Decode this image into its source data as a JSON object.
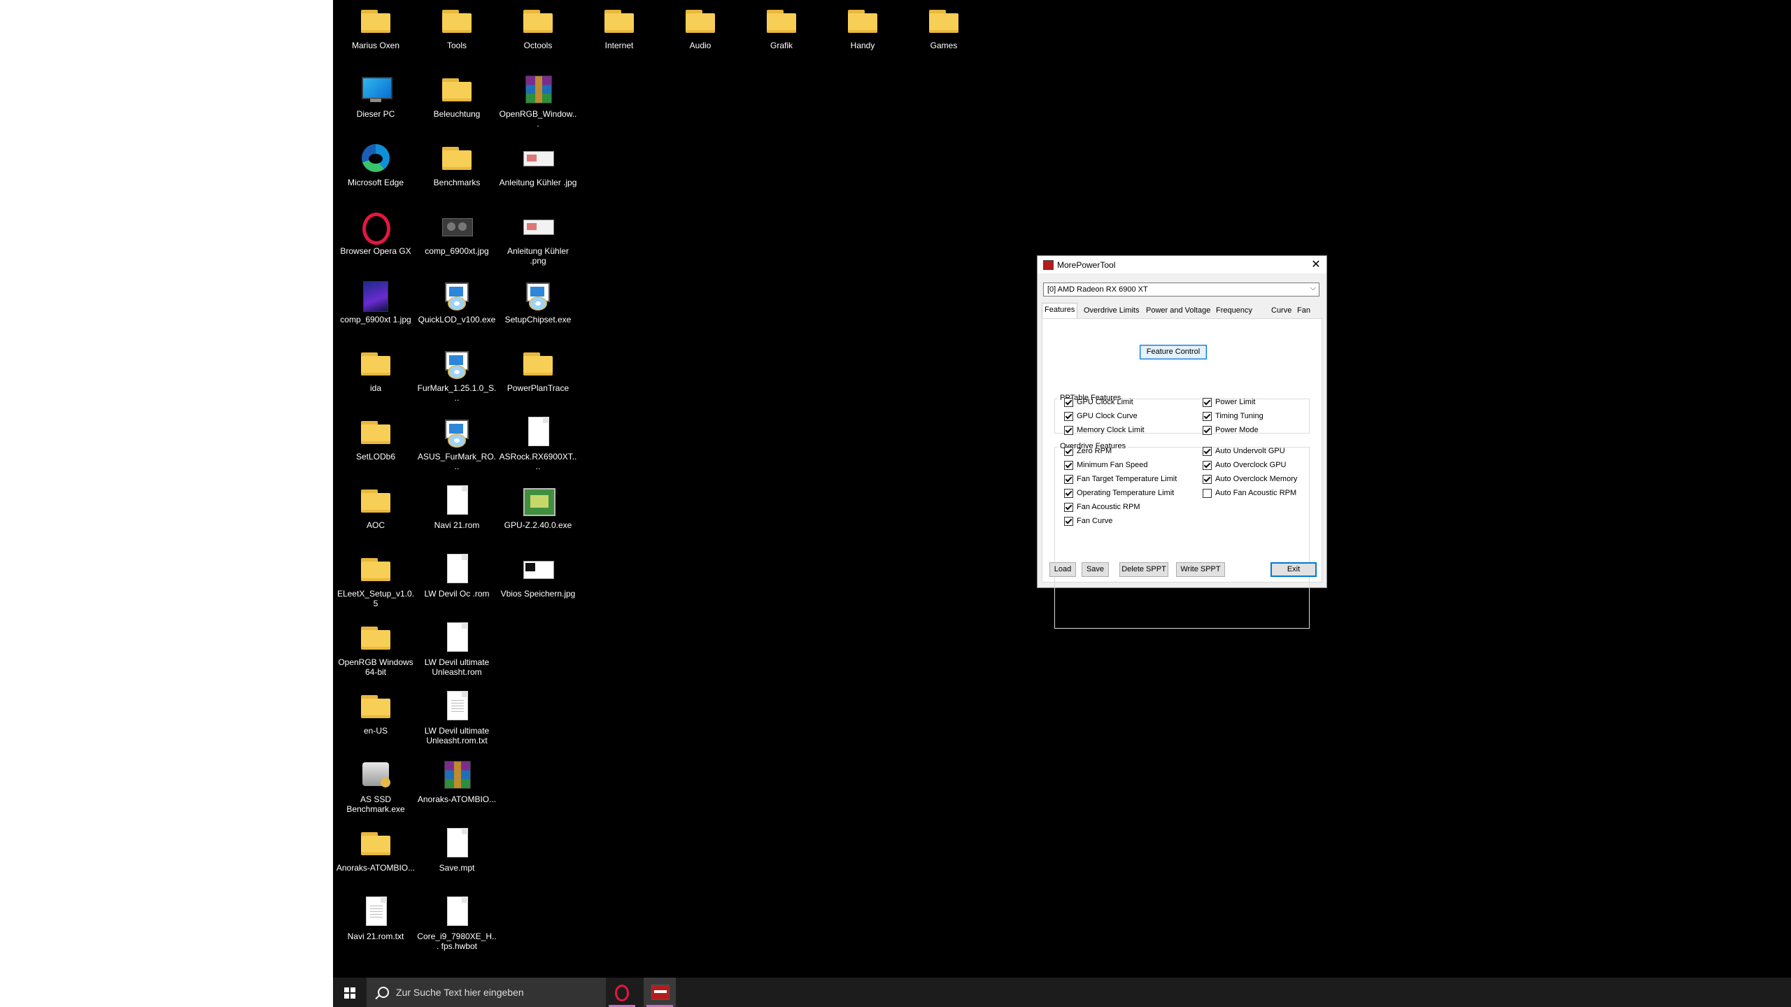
{
  "desktop": {
    "icons": [
      {
        "id": "marius-oxen",
        "label": "Marius Oxen",
        "type": "folder"
      },
      {
        "id": "tools",
        "label": "Tools",
        "type": "folder"
      },
      {
        "id": "octools",
        "label": "Octools",
        "type": "folder"
      },
      {
        "id": "internet",
        "label": "Internet",
        "type": "folder"
      },
      {
        "id": "audio",
        "label": "Audio",
        "type": "folder"
      },
      {
        "id": "grafik",
        "label": "Grafik",
        "type": "folder"
      },
      {
        "id": "handy",
        "label": "Handy",
        "type": "folder"
      },
      {
        "id": "games",
        "label": "Games",
        "type": "folder"
      },
      {
        "id": "dieser-pc",
        "label": "Dieser PC",
        "type": "pc"
      },
      {
        "id": "beleuchtung",
        "label": "Beleuchtung",
        "type": "folder"
      },
      {
        "id": "openrgb-windows-archive",
        "label": "OpenRGB_Window...",
        "type": "rar"
      },
      {
        "id": "microsoft-edge",
        "label": "Microsoft Edge",
        "type": "edge"
      },
      {
        "id": "benchmarks",
        "label": "Benchmarks",
        "type": "folder"
      },
      {
        "id": "anleitung-kuehler-jpg",
        "label": "Anleitung Kühler .jpg",
        "type": "image"
      },
      {
        "id": "browser-opera-gx",
        "label": "Browser Opera GX",
        "type": "opera"
      },
      {
        "id": "comp-6900xt-jpg",
        "label": "comp_6900xt.jpg",
        "type": "gpu-image"
      },
      {
        "id": "anleitung-kuehler-png",
        "label": "Anleitung Kühler .png",
        "type": "image"
      },
      {
        "id": "comp-6900xt-1-jpg",
        "label": "comp_6900xt 1.jpg",
        "type": "photo"
      },
      {
        "id": "quicklod",
        "label": "QuickLOD_v100.exe",
        "type": "setup"
      },
      {
        "id": "setupchipset",
        "label": "SetupChipset.exe",
        "type": "setup"
      },
      {
        "id": "ida",
        "label": "ida",
        "type": "folder"
      },
      {
        "id": "furmark",
        "label": "FurMark_1.25.1.0_S...",
        "type": "setup"
      },
      {
        "id": "powerplantrace",
        "label": "PowerPlanTrace",
        "type": "folder"
      },
      {
        "id": "setlodb6",
        "label": "SetLODb6",
        "type": "folder"
      },
      {
        "id": "asus-furmark",
        "label": "ASUS_FurMark_RO...",
        "type": "setup"
      },
      {
        "id": "asrock-rx6900xt",
        "label": "ASRock.RX6900XT....",
        "type": "doc"
      },
      {
        "id": "aoc",
        "label": "AOC",
        "type": "folder"
      },
      {
        "id": "navi21-rom",
        "label": "Navi 21.rom",
        "type": "doc"
      },
      {
        "id": "gpu-z",
        "label": "GPU-Z.2.40.0.exe",
        "type": "gpuz"
      },
      {
        "id": "eleetx-setup",
        "label": "ELeetX_Setup_v1.0.5",
        "type": "folder"
      },
      {
        "id": "lw-devil-oc-rom",
        "label": "LW Devil Oc .rom",
        "type": "doc"
      },
      {
        "id": "vbios-speichern",
        "label": "Vbios Speichern.jpg",
        "type": "vbios"
      },
      {
        "id": "openrgb-windows-64",
        "label": "OpenRGB Windows 64-bit",
        "type": "folder"
      },
      {
        "id": "lw-devil-ultimate-rom",
        "label": "LW Devil ultimate Unleasht.rom",
        "type": "doc"
      },
      {
        "id": "en-us",
        "label": "en-US",
        "type": "folder"
      },
      {
        "id": "lw-devil-ultimate-txt",
        "label": "LW Devil ultimate Unleasht.rom.txt",
        "type": "doc-lines"
      },
      {
        "id": "as-ssd",
        "label": "AS SSD Benchmark.exe",
        "type": "ssd"
      },
      {
        "id": "anoraks-atombio-archive",
        "label": "Anoraks-ATOMBIO...",
        "type": "rar"
      },
      {
        "id": "anoraks-atombio-folder",
        "label": "Anoraks-ATOMBIO...",
        "type": "folder"
      },
      {
        "id": "save-mpt",
        "label": "Save.mpt",
        "type": "doc"
      },
      {
        "id": "navi21-rom-txt",
        "label": "Navi 21.rom.txt",
        "type": "doc-lines"
      },
      {
        "id": "core-i9-hwbot",
        "label": "Core_i9_7980XE_H... fps.hwbot",
        "type": "doc"
      }
    ]
  },
  "taskbar": {
    "search_placeholder": "Zur Suche Text hier eingeben",
    "apps": [
      {
        "name": "Opera GX",
        "icon": "opera-gx-icon"
      },
      {
        "name": "MorePowerTool",
        "icon": "morepowertool-icon",
        "active": true
      }
    ],
    "accent_color": "#c56fc6"
  },
  "mpt": {
    "title": "MorePowerTool",
    "gpu_select": "[0] AMD Radeon RX 6900 XT",
    "tabs": [
      "Features",
      "Overdrive Limits",
      "Power and Voltage",
      "Frequency",
      "Curve",
      "Fan"
    ],
    "active_tab": "Features",
    "pptable_group": "PPTable Features",
    "feature_control": "Feature Control",
    "overdrive_group": "Overdrive Features",
    "features_left": [
      {
        "label": "GPU Clock Limit",
        "checked": true
      },
      {
        "label": "GPU Clock Curve",
        "checked": true
      },
      {
        "label": "Memory Clock Limit",
        "checked": true
      },
      {
        "label": "Zero RPM",
        "checked": true
      },
      {
        "label": "Minimum Fan Speed",
        "checked": true
      },
      {
        "label": "Fan Target Temperature Limit",
        "checked": true
      },
      {
        "label": "Operating Temperature Limit",
        "checked": true
      },
      {
        "label": "Fan Acoustic RPM",
        "checked": true
      },
      {
        "label": "Fan Curve",
        "checked": true
      }
    ],
    "features_right": [
      {
        "label": "Power Limit",
        "checked": true
      },
      {
        "label": "Timing Tuning",
        "checked": true
      },
      {
        "label": "Power Mode",
        "checked": true
      },
      {
        "label": "Auto Undervolt GPU",
        "checked": true
      },
      {
        "label": "Auto Overclock GPU",
        "checked": true
      },
      {
        "label": "Auto Overclock Memory",
        "checked": true
      },
      {
        "label": "Auto Fan Acoustic RPM",
        "checked": false
      }
    ],
    "buttons": {
      "load": "Load",
      "save": "Save",
      "delete_sppt": "Delete SPPT",
      "write_sppt": "Write SPPT",
      "exit": "Exit"
    }
  }
}
